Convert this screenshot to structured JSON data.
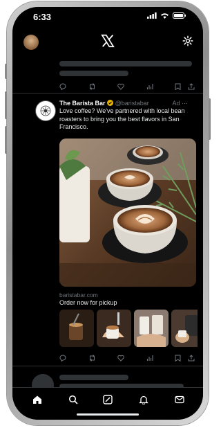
{
  "status": {
    "time": "6:33"
  },
  "tweet": {
    "name": "The Barista Bar",
    "handle": "@baristabar",
    "ad_label": "Ad",
    "text": "Love coffee? We've partnered with local bean roasters to bring you the best flavors in San Francisco.",
    "link_domain": "baristabar.com",
    "cta": "Order now for pickup"
  },
  "icons": {
    "header": [
      "avatar",
      "x-logo-icon",
      "gear-icon"
    ],
    "actions": [
      "reply-icon",
      "retweet-icon",
      "like-icon",
      "views-icon",
      "bookmark-icon",
      "share-icon"
    ],
    "tabs": [
      "home-icon",
      "search-icon",
      "grok-icon",
      "notifications-icon",
      "messages-icon"
    ]
  },
  "colors": {
    "accent": "#1d9bf0",
    "background": "#000000",
    "text": "#e7e9ea",
    "muted": "#71767b"
  }
}
